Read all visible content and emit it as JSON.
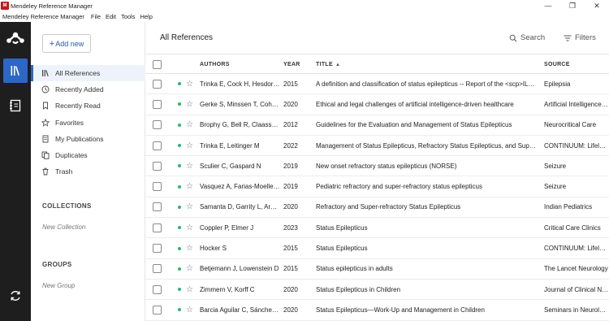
{
  "window": {
    "title": "Mendeley Reference Manager",
    "app_icon_text": "M",
    "controls": {
      "minimize": "—",
      "restore": "❐",
      "close": "✕"
    }
  },
  "menu": [
    "Mendeley Reference Manager",
    "File",
    "Edit",
    "Tools",
    "Help"
  ],
  "sidebar": {
    "add_new_label": "Add new",
    "nav": [
      {
        "label": "All References",
        "icon": "library-icon",
        "active": true
      },
      {
        "label": "Recently Added",
        "icon": "clock-icon"
      },
      {
        "label": "Recently Read",
        "icon": "bookmark-icon"
      },
      {
        "label": "Favorites",
        "icon": "star-icon"
      },
      {
        "label": "My Publications",
        "icon": "document-icon"
      },
      {
        "label": "Duplicates",
        "icon": "duplicate-icon"
      },
      {
        "label": "Trash",
        "icon": "trash-icon"
      }
    ],
    "collections_header": "COLLECTIONS",
    "new_collection": "New Collection",
    "groups_header": "GROUPS",
    "new_group": "New Group"
  },
  "main": {
    "title": "All References",
    "search_label": "Search",
    "filters_label": "Filters",
    "columns": {
      "authors": "AUTHORS",
      "year": "YEAR",
      "title": "TITLE",
      "source": "SOURCE"
    },
    "sort_indicator": "▲",
    "rows": [
      {
        "authors": "Trinka E, Cock H, Hesdorffer D",
        "year": "2015",
        "title": "A definition and classification of status epilepticus -- Report of the <scp>ILAE</scp> Task Force",
        "source": "Epilepsia"
      },
      {
        "authors": "Gerke S, Minssen T, Cohen G",
        "year": "2020",
        "title": "Ethical and legal challenges of artificial intelligence-driven healthcare",
        "source": "Artificial Intelligence in Healthcare"
      },
      {
        "authors": "Brophy G, Bell R, Claassen J",
        "year": "2012",
        "title": "Guidelines for the Evaluation and Management of Status Epilepticus",
        "source": "Neurocritical Care"
      },
      {
        "authors": "Trinka E, Leitinger M",
        "year": "2022",
        "title": "Management of Status Epilepticus, Refractory Status Epilepticus, and Super-Refractory Status Epilepticus",
        "source": "CONTINUUM: Lifelong Learning"
      },
      {
        "authors": "Sculier C, Gaspard N",
        "year": "2019",
        "title": "New onset refractory status epilepticus (NORSE)",
        "source": "Seizure"
      },
      {
        "authors": "Vasquez A, Farias-Moeller R",
        "year": "2019",
        "title": "Pediatric refractory and super-refractory status epilepticus",
        "source": "Seizure"
      },
      {
        "authors": "Samanta D, Garrity L, Arya R",
        "year": "2020",
        "title": "Refractory and Super-refractory Status Epilepticus",
        "source": "Indian Pediatrics"
      },
      {
        "authors": "Coppler P, Elmer J",
        "year": "2023",
        "title": "Status Epilepticus",
        "source": "Critical Care Clinics"
      },
      {
        "authors": "Hocker S",
        "year": "2015",
        "title": "Status Epilepticus",
        "source": "CONTINUUM: Lifelong Learning"
      },
      {
        "authors": "Betjemann J, Lowenstein D",
        "year": "2015",
        "title": "Status epilepticus in adults",
        "source": "The Lancet Neurology"
      },
      {
        "authors": "Zimmern V, Korff C",
        "year": "2020",
        "title": "Status Epilepticus in Children",
        "source": "Journal of Clinical Neurophysiology"
      },
      {
        "authors": "Barcia Aguilar C, Sánchez Fernández I",
        "year": "2020",
        "title": "Status Epilepticus—Work-Up and Management in Children",
        "source": "Seminars in Neurology"
      }
    ]
  },
  "colors": {
    "accent": "#2c67c6",
    "rail_bg": "#1e1e1e",
    "read_dot": "#2fb56a",
    "add_new_text": "#2b58a6"
  }
}
